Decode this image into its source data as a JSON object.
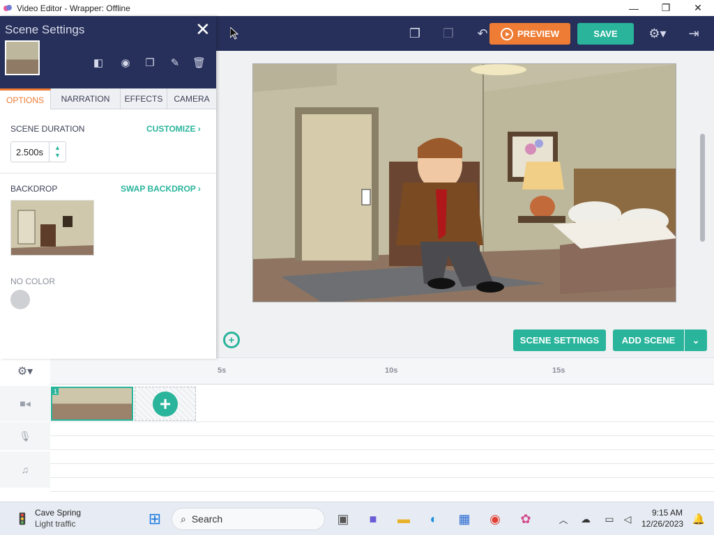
{
  "window": {
    "title": "Video Editor - Wrapper: Offline",
    "min_glyph": "—",
    "max_glyph": "❐",
    "close_glyph": "✕"
  },
  "topbar": {
    "preview_label": "PREVIEW",
    "save_label": "SAVE"
  },
  "panel": {
    "title": "Scene Settings",
    "close_glyph": "✕",
    "tabs": [
      "OPTIONS",
      "NARRATION",
      "EFFECTS",
      "CAMERA"
    ],
    "active_tab": "OPTIONS",
    "scene_duration_label": "SCENE DURATION",
    "customize_label": "CUSTOMIZE ›",
    "duration_value": "2.500s",
    "backdrop_label": "BACKDROP",
    "swap_backdrop_label": "SWAP BACKDROP ›",
    "color_label": "NO COLOR"
  },
  "stage_buttons": {
    "scene_settings": "SCENE SETTINGS",
    "add_scene": "ADD SCENE"
  },
  "timeline": {
    "ticks": [
      "5s",
      "10s",
      "15s"
    ],
    "clip_number": "1"
  },
  "taskbar": {
    "weather_title": "Cave Spring",
    "weather_sub": "Light traffic",
    "search_label": "Search",
    "time": "9:15 AM",
    "date": "12/26/2023"
  },
  "colors": {
    "navy": "#27305a",
    "teal": "#29b49b",
    "orange": "#ee7c34"
  }
}
